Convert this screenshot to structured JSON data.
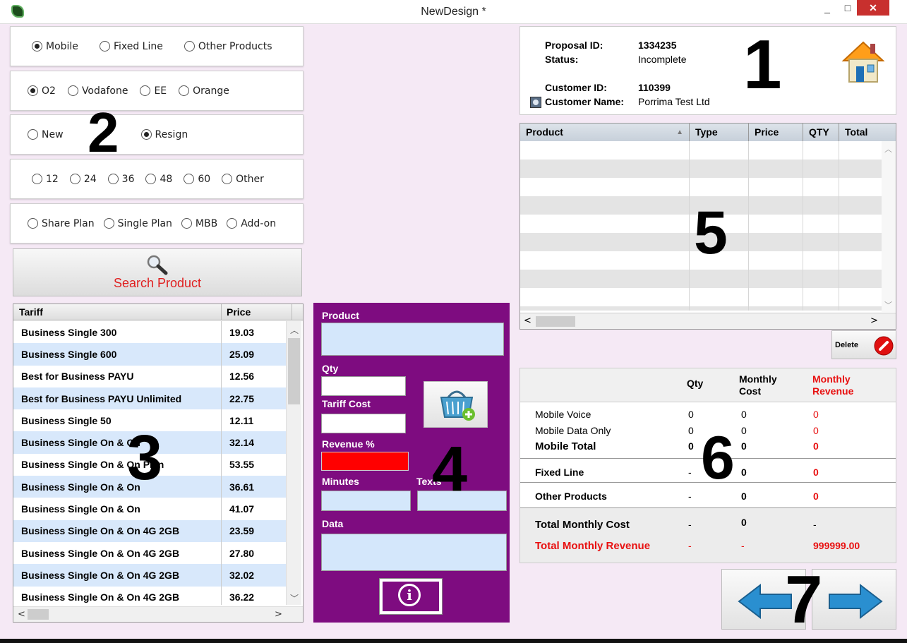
{
  "window": {
    "title": "NewDesign *",
    "minimize": "_",
    "maximize": "□",
    "close": "✕"
  },
  "callouts": [
    "1",
    "2",
    "3",
    "4",
    "5",
    "6",
    "7"
  ],
  "service_type": {
    "options": [
      "Mobile",
      "Fixed Line",
      "Other Products"
    ],
    "selected": "Mobile"
  },
  "network": {
    "options": [
      "O2",
      "Vodafone",
      "EE",
      "Orange"
    ],
    "selected": "O2"
  },
  "contract_type": {
    "options": [
      "New",
      "Resign"
    ],
    "selected": "Resign"
  },
  "term": {
    "options": [
      "12",
      "24",
      "36",
      "48",
      "60",
      "Other"
    ],
    "selected": ""
  },
  "plan_type": {
    "options": [
      "Share Plan",
      "Single Plan",
      "MBB",
      "Add-on"
    ],
    "selected": ""
  },
  "search": {
    "label": "Search Product"
  },
  "tariffs": {
    "columns": [
      "Tariff",
      "Price"
    ],
    "rows": [
      {
        "name": "Business Single 300",
        "price": "19.03"
      },
      {
        "name": "Business Single 600",
        "price": "25.09"
      },
      {
        "name": "Best for Business PAYU",
        "price": "12.56"
      },
      {
        "name": "Best for Business PAYU Unlimited",
        "price": "22.75"
      },
      {
        "name": "Business Single 50",
        "price": "12.11"
      },
      {
        "name": "Business Single On & On",
        "price": "32.14"
      },
      {
        "name": "Business Single On & On Plan",
        "price": "53.55"
      },
      {
        "name": "Business Single On & On",
        "price": "36.61"
      },
      {
        "name": "Business Single On & On",
        "price": "41.07"
      },
      {
        "name": "Business Single On & On 4G 2GB",
        "price": "23.59"
      },
      {
        "name": "Business Single On & On 4G 2GB",
        "price": "27.80"
      },
      {
        "name": "Business Single On & On 4G 2GB",
        "price": "32.02"
      },
      {
        "name": "Business Single On & On 4G 2GB",
        "price": "36.22"
      }
    ]
  },
  "product_form": {
    "product_label": "Product",
    "qty_label": "Qty",
    "tariff_cost_label": "Tariff Cost",
    "revenue_label": "Revenue %",
    "minutes_label": "Minutes",
    "texts_label": "Texts",
    "data_label": "Data",
    "info_icon": "i"
  },
  "proposal": {
    "proposal_id_label": "Proposal ID:",
    "proposal_id": "1334235",
    "status_label": "Status:",
    "status": "Incomplete",
    "customer_id_label": "Customer ID:",
    "customer_id": "110399",
    "customer_name_label": "Customer Name:",
    "customer_name": "Porrima Test Ltd"
  },
  "order_table": {
    "columns": [
      "Product",
      "Type",
      "Price",
      "QTY",
      "Total"
    ],
    "rows": []
  },
  "delete": {
    "label": "Delete"
  },
  "summary": {
    "headers": {
      "qty": "Qty",
      "monthly_cost": "Monthly Cost",
      "monthly_revenue": "Monthly Revenue"
    },
    "rows": [
      {
        "label": "Mobile Voice",
        "qty": "0",
        "cost": "0",
        "revenue": "0"
      },
      {
        "label": "Mobile Data Only",
        "qty": "0",
        "cost": "0",
        "revenue": "0"
      },
      {
        "label": "Mobile Total",
        "qty": "0",
        "cost": "0",
        "revenue": "0"
      },
      {
        "label": "Fixed Line",
        "qty": "-",
        "cost": "0",
        "revenue": "0"
      },
      {
        "label": "Other Products",
        "qty": "-",
        "cost": "0",
        "revenue": "0"
      },
      {
        "label": "Total Monthly Cost",
        "qty": "-",
        "cost": "0",
        "revenue": "-"
      },
      {
        "label": "Total Monthly Revenue",
        "qty": "-",
        "cost": "-",
        "revenue": "999999.00"
      }
    ]
  },
  "colors": {
    "purple_panel": "#7e0c80",
    "revenue_field": "#ff0000",
    "accent_red": "#e81010",
    "row_alt": "#d8e8fb"
  }
}
